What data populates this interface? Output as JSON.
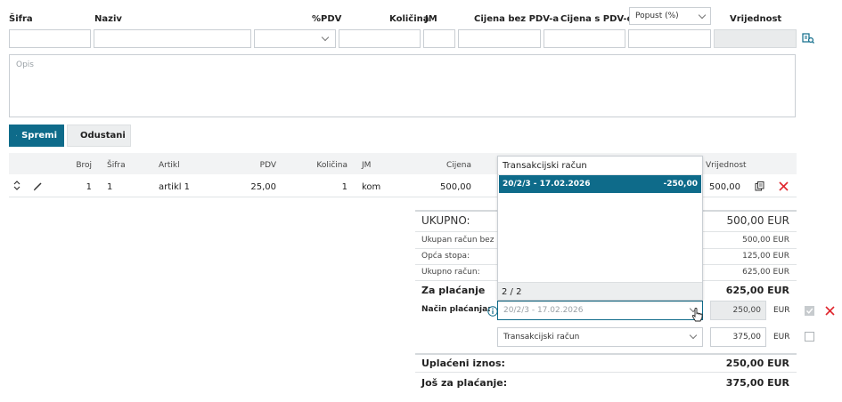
{
  "form": {
    "headers": {
      "sifra": "Šifra",
      "naziv": "Naziv",
      "pdv": "%PDV",
      "kolicina": "Količina",
      "jm": "JM",
      "cijena_bez": "Cijena bez PDV-a",
      "cijena_s": "Cijena s PDV-om",
      "vrijednost": "Vrijednost"
    },
    "popust_select": "Popust (%)",
    "opis_placeholder": "Opis"
  },
  "buttons": {
    "save": "Spremi",
    "cancel": "Odustani"
  },
  "table": {
    "columns": {
      "broj": "Broj",
      "sifra": "Šifra",
      "artikl": "Artikl",
      "pdv": "PDV",
      "kolicina": "Količina",
      "jm": "JM",
      "cijena": "Cijena",
      "vrijednost": "Vrijednost"
    },
    "row": {
      "broj": "1",
      "sifra": "1",
      "artikl": "artikl 1",
      "pdv": "25,00",
      "kolicina": "1",
      "jm": "kom",
      "cijena": "500,00",
      "vrijednost": "500,00"
    }
  },
  "summary": {
    "ukupno_label": "UKUPNO:",
    "ukupno_value": "500,00 EUR",
    "bez_pdv_label": "Ukupan račun bez P",
    "bez_pdv_value": "500,00 EUR",
    "opca_label": "Opća stopa:",
    "opca_value": "125,00 EUR",
    "ukupno_racun_label": "Ukupno račun:",
    "ukupno_racun_value": "625,00 EUR",
    "za_placanje_label": "Za plaćanje",
    "za_placanje_value": "625,00 EUR",
    "nacin_label": "Način plaćanja:",
    "uplaceni_label": "Uplaćeni iznos:",
    "uplaceni_value": "250,00 EUR",
    "jos_label": "Još za plaćanje:",
    "jos_value": "375,00 EUR"
  },
  "payment": {
    "row1_placeholder": "20/2/3 - 17.02.2026",
    "row1_amount": "250,00",
    "row1_currency": "EUR",
    "row2_select": "Transakcijski račun",
    "row2_amount": "375,00",
    "row2_currency": "EUR"
  },
  "dropdown": {
    "header": "Transakcijski račun",
    "option_label": "20/2/3 - 17.02.2026",
    "option_amount": "-250,00",
    "footer": "2 / 2"
  },
  "colors": {
    "accent": "#0e6b8a",
    "delete": "#e0262d"
  }
}
